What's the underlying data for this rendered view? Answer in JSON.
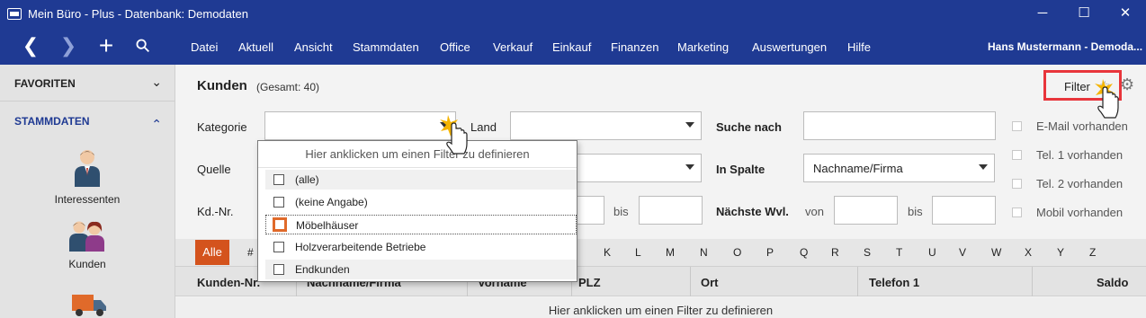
{
  "window": {
    "title": "Mein Büro - Plus - Datenbank: Demodaten",
    "minimize_glyph": "─",
    "maximize_glyph": "☐",
    "close_glyph": "✕"
  },
  "nav": {
    "back_glyph": "❮",
    "forward_glyph": "❯",
    "add_glyph": "+",
    "search_glyph": "⚲"
  },
  "menu": {
    "items": [
      "Datei",
      "Aktuell",
      "Ansicht",
      "Stammdaten",
      "Office",
      "Verkauf",
      "Einkauf",
      "Finanzen",
      "Marketing",
      "Auswertungen",
      "Hilfe"
    ],
    "user": "Hans Mustermann - Demoda..."
  },
  "sidebar": {
    "favorites_label": "FAVORITEN",
    "stammdaten_label": "STAMMDATEN",
    "chevron_down": "⌄",
    "chevron_up": "⌃",
    "entries": [
      "Interessenten",
      "Kunden"
    ]
  },
  "header": {
    "title": "Kunden",
    "count": "(Gesamt: 40)",
    "filter_label": "Filter",
    "star_glyph": "☆",
    "gear_glyph": "⚙"
  },
  "filters": {
    "kategorie_label": "Kategorie",
    "land_label": "Land",
    "suche_label": "Suche nach",
    "quelle_label": "Quelle",
    "in_spalte_label": "In Spalte",
    "in_spalte_value": "Nachname/Firma",
    "kdnr_label": "Kd.-Nr.",
    "bis_label": "bis",
    "wvl_label": "Nächste Wvl.",
    "von_label": "von",
    "bis2_label": "bis",
    "checkboxes": [
      "E-Mail vorhanden",
      "Tel. 1 vorhanden",
      "Tel. 2 vorhanden",
      "Mobil vorhanden"
    ]
  },
  "dropdown": {
    "hint": "Hier anklicken um einen Filter zu definieren",
    "options": [
      "(alle)",
      "(keine Angabe)",
      "Möbelhäuser",
      "Holzverarbeitende Betriebe",
      "Endkunden"
    ],
    "selected_index": 2
  },
  "alphabet": {
    "all_label": "Alle",
    "letters": [
      "#",
      "K",
      "L",
      "M",
      "N",
      "O",
      "P",
      "Q",
      "R",
      "S",
      "T",
      "U",
      "V",
      "W",
      "X",
      "Y",
      "Z"
    ]
  },
  "table": {
    "columns": [
      "Kunden-Nr.",
      "Nachname/Firma",
      "Vorname",
      "PLZ",
      "Ort",
      "Telefon 1",
      "Saldo"
    ],
    "filter_hint": "Hier anklicken um einen Filter zu definieren"
  },
  "colors": {
    "titlebar": "#1f3a93",
    "accent_orange": "#d4531d",
    "highlight_red": "#e8353b"
  }
}
